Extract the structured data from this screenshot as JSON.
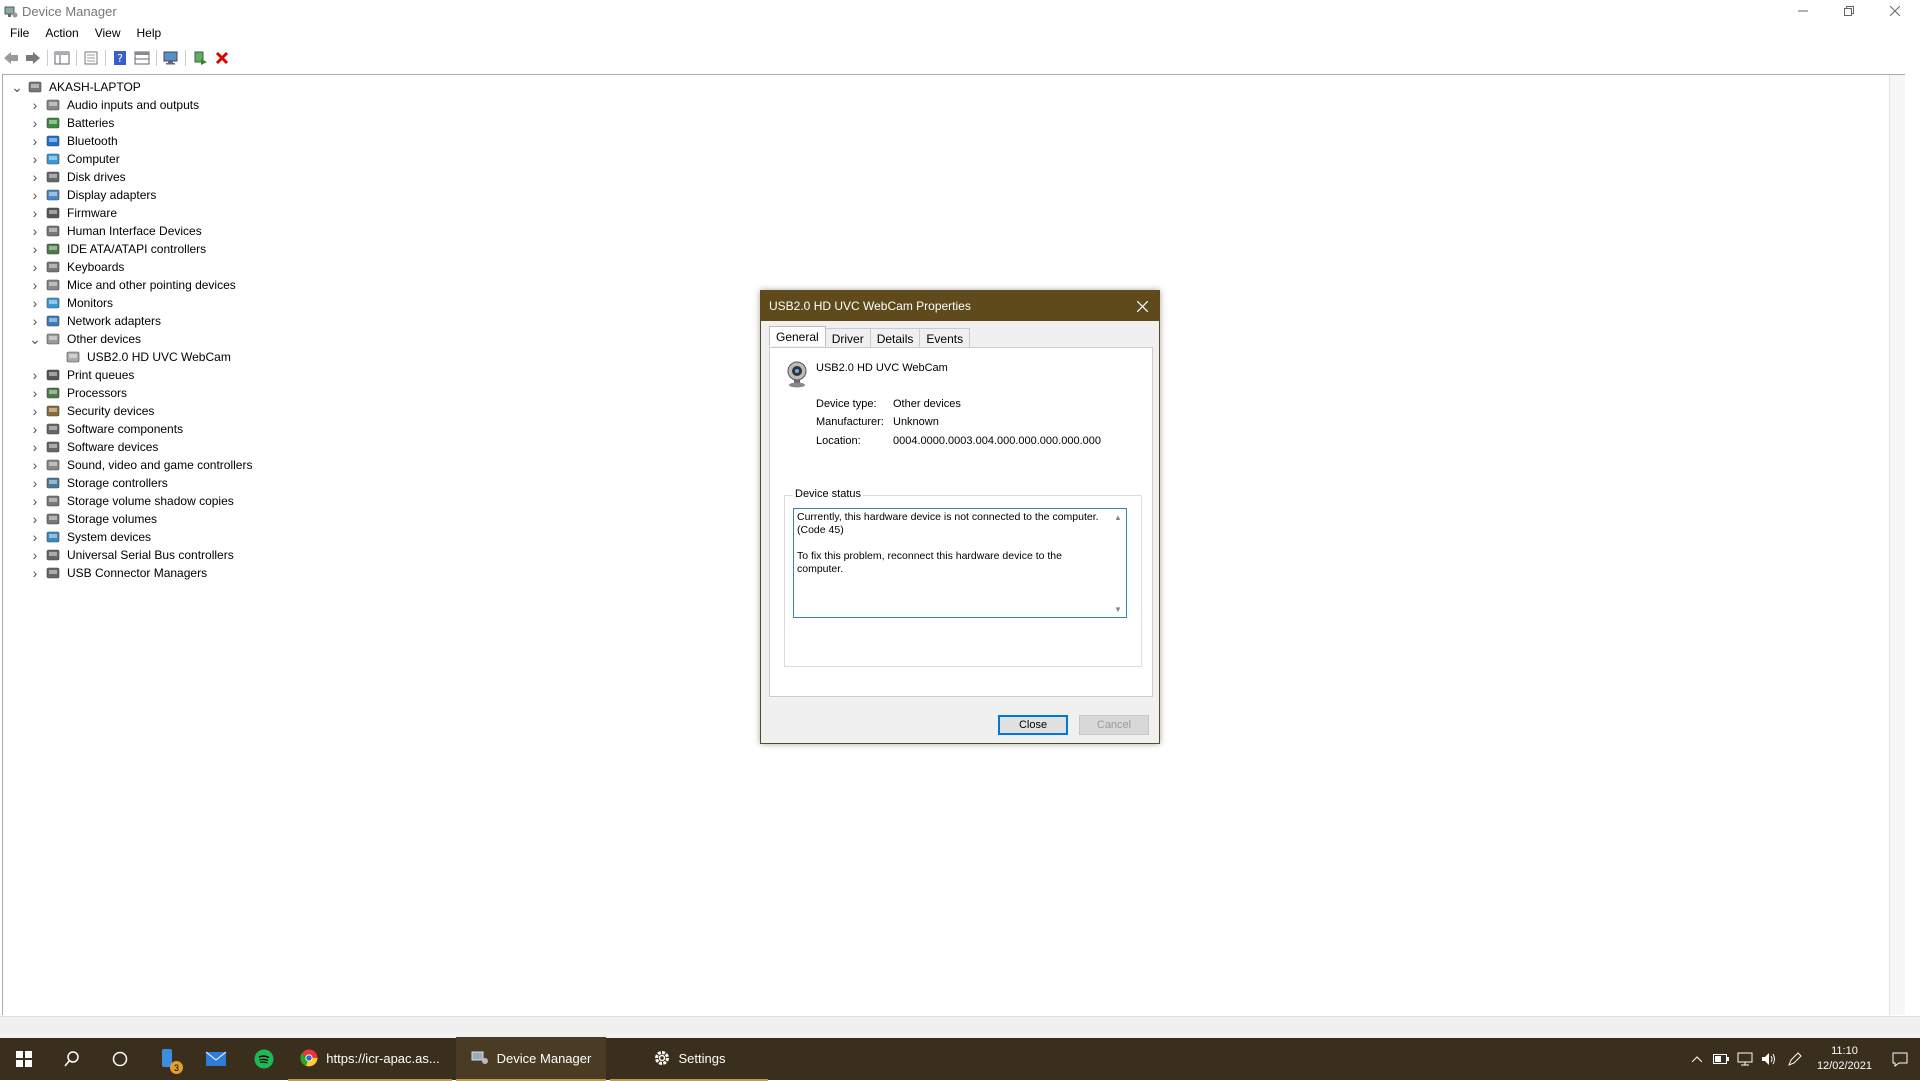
{
  "window": {
    "title": "Device Manager"
  },
  "menu": [
    "File",
    "Action",
    "View",
    "Help"
  ],
  "toolbar": {
    "buttons": [
      "back-arrow-icon",
      "forward-arrow-icon",
      "show-hide-tree-icon",
      "properties-icon",
      "help-icon",
      "view-pane-icon",
      "monitor-scan-icon",
      "add-driver-icon",
      "uninstall-x-icon"
    ]
  },
  "tree": {
    "root": "AKASH-LAPTOP",
    "categories": [
      {
        "label": "Audio inputs and outputs",
        "icon": "speaker-icon"
      },
      {
        "label": "Batteries",
        "icon": "battery-icon"
      },
      {
        "label": "Bluetooth",
        "icon": "bluetooth-icon"
      },
      {
        "label": "Computer",
        "icon": "computer-icon"
      },
      {
        "label": "Disk drives",
        "icon": "disk-icon"
      },
      {
        "label": "Display adapters",
        "icon": "display-adapter-icon"
      },
      {
        "label": "Firmware",
        "icon": "firmware-icon"
      },
      {
        "label": "Human Interface Devices",
        "icon": "hid-icon"
      },
      {
        "label": "IDE ATA/ATAPI controllers",
        "icon": "ide-controller-icon"
      },
      {
        "label": "Keyboards",
        "icon": "keyboard-icon"
      },
      {
        "label": "Mice and other pointing devices",
        "icon": "mouse-icon"
      },
      {
        "label": "Monitors",
        "icon": "monitor-icon"
      },
      {
        "label": "Network adapters",
        "icon": "network-icon"
      },
      {
        "label": "Other devices",
        "icon": "other-device-icon",
        "expanded": true,
        "children": [
          {
            "label": "USB2.0 HD UVC WebCam",
            "icon": "webcam-warning-icon"
          }
        ]
      },
      {
        "label": "Print queues",
        "icon": "printer-icon"
      },
      {
        "label": "Processors",
        "icon": "processor-icon"
      },
      {
        "label": "Security devices",
        "icon": "security-icon"
      },
      {
        "label": "Software components",
        "icon": "software-component-icon"
      },
      {
        "label": "Software devices",
        "icon": "software-device-icon"
      },
      {
        "label": "Sound, video and game controllers",
        "icon": "sound-icon"
      },
      {
        "label": "Storage controllers",
        "icon": "storage-controller-icon"
      },
      {
        "label": "Storage volume shadow copies",
        "icon": "shadow-copy-icon"
      },
      {
        "label": "Storage volumes",
        "icon": "storage-volume-icon"
      },
      {
        "label": "System devices",
        "icon": "system-icon"
      },
      {
        "label": "Universal Serial Bus controllers",
        "icon": "usb-icon"
      },
      {
        "label": "USB Connector Managers",
        "icon": "usb-connector-icon"
      }
    ]
  },
  "dialog": {
    "title": "USB2.0 HD UVC WebCam Properties",
    "tabs": [
      "General",
      "Driver",
      "Details",
      "Events"
    ],
    "active_tab": "General",
    "device_name": "USB2.0 HD UVC WebCam",
    "device_type_label": "Device type:",
    "device_type": "Other devices",
    "manufacturer_label": "Manufacturer:",
    "manufacturer": "Unknown",
    "location_label": "Location:",
    "location": "0004.0000.0003.004.000.000.000.000.000",
    "status_label": "Device status",
    "status_line1": "Currently, this hardware device is not connected to the computer. (Code 45)",
    "status_line2": "To fix this problem, reconnect this hardware device to the computer.",
    "close_button": "Close",
    "cancel_button": "Cancel"
  },
  "taskbar": {
    "chrome_label": "https://icr-apac.as...",
    "device_manager_label": "Device Manager",
    "settings_label": "Settings",
    "badge_count": "3",
    "time": "11:10",
    "date": "12/02/2021"
  },
  "colors": {
    "titlebar_dialog": "#5e4a1b",
    "taskbar": "#3a2e1c",
    "focus_blue": "#0078d7"
  }
}
